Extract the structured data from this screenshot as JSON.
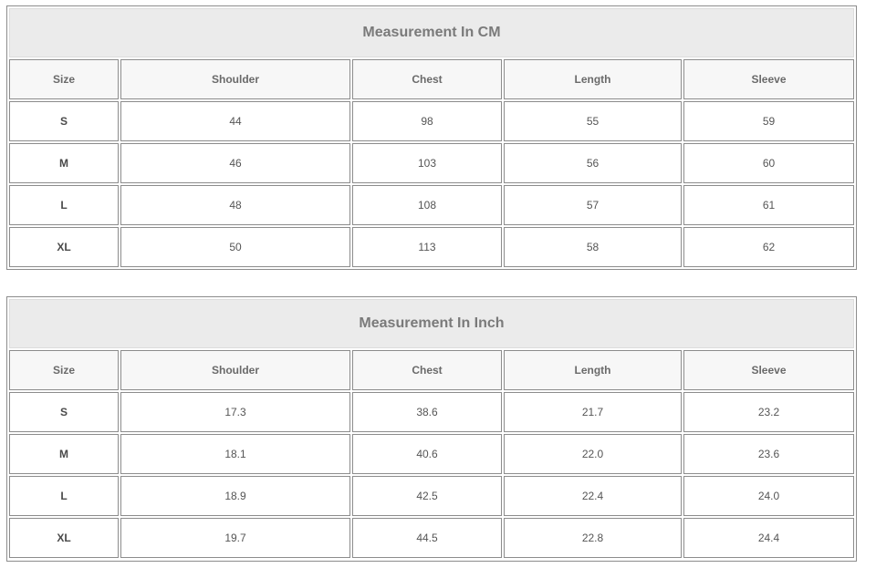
{
  "cm_table": {
    "title": "Measurement In CM",
    "headers": [
      "Size",
      "Shoulder",
      "Chest",
      "Length",
      "Sleeve"
    ],
    "rows": [
      [
        "S",
        "44",
        "98",
        "55",
        "59"
      ],
      [
        "M",
        "46",
        "103",
        "56",
        "60"
      ],
      [
        "L",
        "48",
        "108",
        "57",
        "61"
      ],
      [
        "XL",
        "50",
        "113",
        "58",
        "62"
      ]
    ]
  },
  "inch_table": {
    "title": "Measurement In Inch",
    "headers": [
      "Size",
      "Shoulder",
      "Chest",
      "Length",
      "Sleeve"
    ],
    "rows": [
      [
        "S",
        "17.3",
        "38.6",
        "21.7",
        "23.2"
      ],
      [
        "M",
        "18.1",
        "40.6",
        "22.0",
        "23.6"
      ],
      [
        "L",
        "18.9",
        "42.5",
        "22.4",
        "24.0"
      ],
      [
        "XL",
        "19.7",
        "44.5",
        "22.8",
        "24.4"
      ]
    ]
  }
}
